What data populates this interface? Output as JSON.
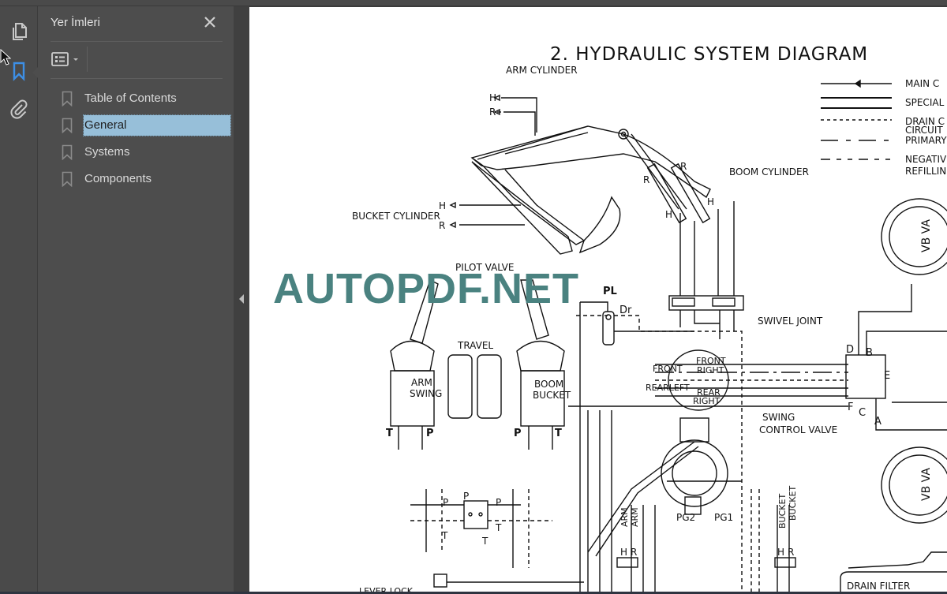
{
  "panel": {
    "title": "Yer İmleri",
    "close_icon": "close-icon",
    "options_icon": "list-options-icon",
    "bookmarks": [
      {
        "label": "Table of Contents",
        "selected": false
      },
      {
        "label": "General",
        "selected": true
      },
      {
        "label": "Systems",
        "selected": false
      },
      {
        "label": "Components",
        "selected": false
      }
    ]
  },
  "rail": {
    "items": [
      {
        "icon": "page-thumbnails-icon",
        "active": false
      },
      {
        "icon": "bookmark-icon",
        "active": true
      },
      {
        "icon": "attachment-icon",
        "active": false
      }
    ],
    "active_color": "#3d8fe6"
  },
  "document": {
    "heading": "2.   HYDRAULIC SYSTEM DIAGRAM",
    "watermark": "AUTOPDF.NET",
    "legend": [
      {
        "style": "solid-arrow",
        "label": "MAIN C"
      },
      {
        "style": "double-solid",
        "label": "SPECIAL"
      },
      {
        "style": "dashed",
        "label": "DRAIN C"
      },
      {
        "style": "text-only",
        "label": "CIRCUIT"
      },
      {
        "style": "dash-dot",
        "label": "PRIMARY"
      },
      {
        "style": "dash-dash-long",
        "label": "NEGATIV"
      },
      {
        "style": "text-only",
        "label": "REFILLIN"
      }
    ],
    "labels": {
      "arm_cylinder": "ARM CYLINDER",
      "boom_cylinder": "BOOM CYLINDER",
      "bucket_cylinder": "BUCKET CYLINDER",
      "pilot_valve": "PILOT VALVE",
      "travel": "TRAVEL",
      "arm": "ARM",
      "swing": "SWING",
      "boom": "BOOM",
      "bucket": "BUCKET",
      "pl": "PL",
      "dr": "Dr",
      "swivel_joint": "SWIVEL JOINT",
      "front": "FRONT",
      "right": "RIGHT",
      "left": "LEFT",
      "rear": "REAR",
      "rearleft": "REARLEFT",
      "swing_control_valve_1": "SWING",
      "swing_control_valve_2": "CONTROL VALVE",
      "pg1": "PG1",
      "pg2": "PG2",
      "drain_filter": "DRAIN FILTER",
      "lever_lock": "LEVER LOCK",
      "h": "H",
      "r": "R",
      "p": "P",
      "t": "T",
      "a": "A",
      "b": "B",
      "c": "C",
      "d": "D",
      "e": "E",
      "f": "F",
      "motor_tag": "VB VA"
    }
  }
}
